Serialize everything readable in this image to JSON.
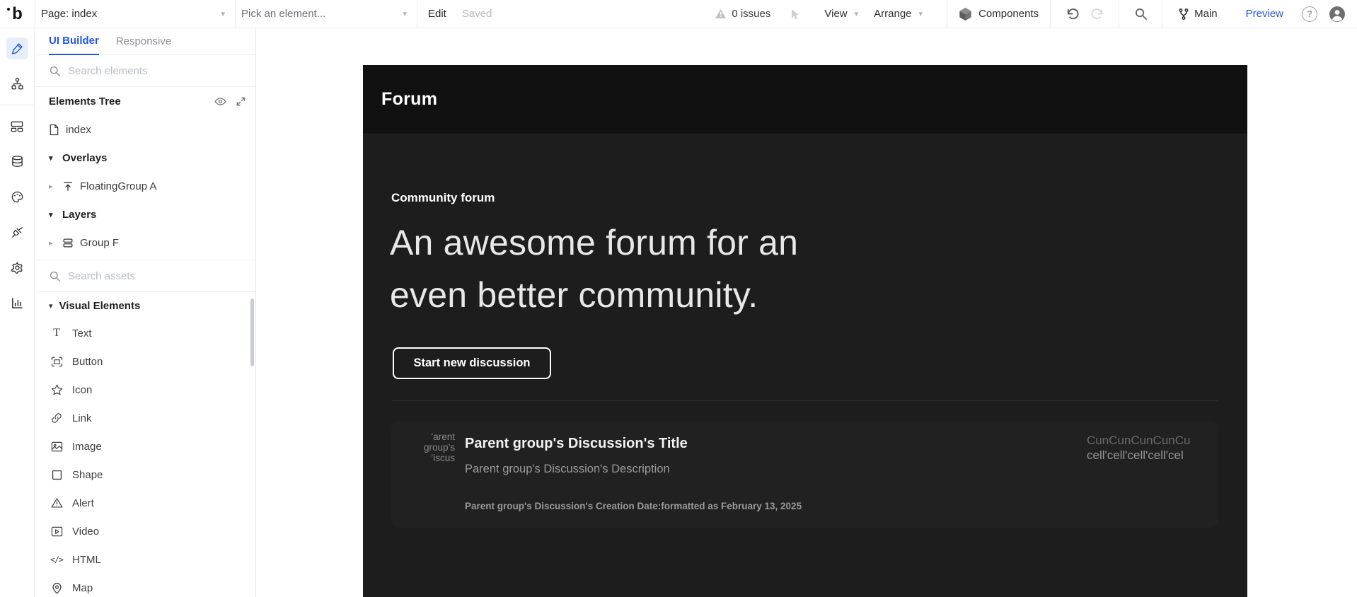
{
  "topbar": {
    "page_selector": "Page: index",
    "element_picker": "Pick an element...",
    "edit_label": "Edit",
    "saved_label": "Saved",
    "issues_label": "0 issues",
    "view_label": "View",
    "arrange_label": "Arrange",
    "components_label": "Components",
    "branch_label": "Main",
    "preview_label": "Preview",
    "help_label": "?"
  },
  "rail_icons": [
    "edit-pencil",
    "component-tree",
    "layout-frames",
    "database",
    "palette",
    "plug",
    "settings-gear",
    "analytics-chart"
  ],
  "panel": {
    "tabs": {
      "builder": "UI Builder",
      "responsive": "Responsive"
    },
    "search_elements_placeholder": "Search elements",
    "tree_title": "Elements Tree",
    "tree": {
      "index_label": "index",
      "overlays_label": "Overlays",
      "floating_group_label": "FloatingGroup A",
      "layers_label": "Layers",
      "group_f_label": "Group F"
    },
    "search_assets_placeholder": "Search assets",
    "visual_elements_title": "Visual Elements",
    "elements": [
      "Text",
      "Button",
      "Icon",
      "Link",
      "Image",
      "Shape",
      "Alert",
      "Video",
      "HTML",
      "Map"
    ]
  },
  "canvas": {
    "header_title": "Forum",
    "eyebrow": "Community forum",
    "heading_line1": "An awesome forum for an",
    "heading_line2": "even better community.",
    "cta_label": "Start new discussion",
    "card": {
      "thumb_line1": "’arent",
      "thumb_line2": "group’s",
      "thumb_line3": "’iscus",
      "title": "Parent group's Discussion's Title",
      "description": "Parent group's Discussion's Description",
      "date": "Parent group's Discussion's Creation Date:formatted as February 13, 2025",
      "right_line1": "CunCunCunCunCu",
      "right_line2": "cell'cell'cell'cell'cel"
    }
  },
  "colors": {
    "accent_blue": "#2457e6",
    "forum_header_bg": "#111111",
    "forum_body_bg": "#1d1d1d",
    "card_bg": "#212121"
  }
}
